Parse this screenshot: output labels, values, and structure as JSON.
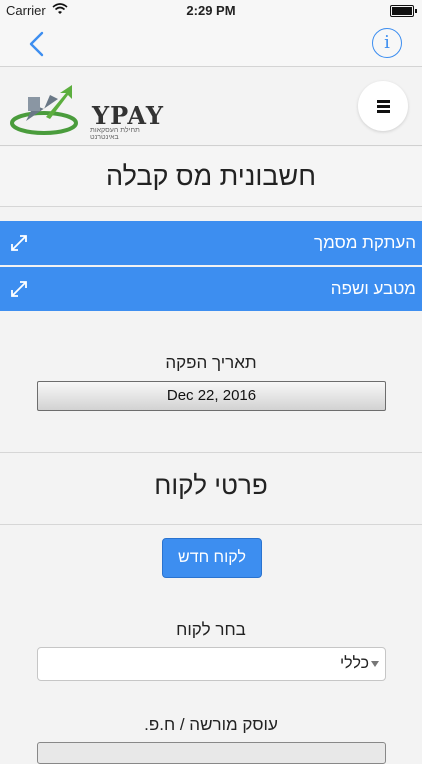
{
  "status_bar": {
    "carrier": "Carrier",
    "time": "2:29 PM"
  },
  "nav": {
    "back_icon": "chevron-left-icon",
    "info_glyph": "i",
    "accent": "#3d8ef0"
  },
  "brand": {
    "logo_word": "YPAY",
    "tagline": "תחילת העסקאות באינטרנט"
  },
  "page": {
    "title": "חשבונית מס קבלה"
  },
  "accordions": [
    {
      "label": "העתקת מסמך"
    },
    {
      "label": "מטבע ושפה"
    }
  ],
  "issue_date": {
    "label": "תאריך הפקה",
    "value": "Dec 22, 2016"
  },
  "customer": {
    "heading": "פרטי לקוח",
    "new_button": "לקוח חדש",
    "select_label": "בחר לקוח",
    "select_value": "כללי",
    "dealer_label": "עוסק מורשה / ח.פ."
  }
}
